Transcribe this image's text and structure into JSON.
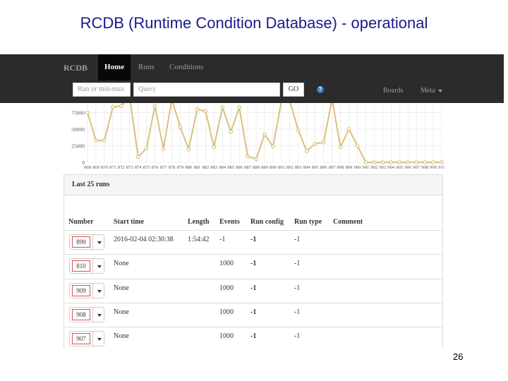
{
  "slide": {
    "title": "RCDB (Runtime Condition Database) - operational",
    "page_number": "26"
  },
  "navbar": {
    "brand": "RCDB",
    "home": "Home",
    "runs": "Runs",
    "conditions": "Conditions",
    "run_range_placeholder": "Run or min-max",
    "query_placeholder": "Query",
    "go": "GO",
    "help_icon": "question-icon",
    "boards": "Boards",
    "meta": "Meta",
    "colors": {
      "bg": "#2b2b2b",
      "active": "#080808"
    }
  },
  "chart_data": {
    "type": "line",
    "x": [
      "868",
      "869",
      "870",
      "871",
      "872",
      "873",
      "874",
      "875",
      "876",
      "877",
      "878",
      "879",
      "880",
      "881",
      "882",
      "883",
      "884",
      "885",
      "886",
      "887",
      "888",
      "889",
      "890",
      "891",
      "892",
      "893",
      "894",
      "895",
      "896",
      "897",
      "898",
      "899",
      "900",
      "901",
      "902",
      "903",
      "904",
      "905",
      "906",
      "907",
      "908",
      "909",
      "910"
    ],
    "x_tick_labels": [
      "868",
      "869",
      "870",
      "871",
      "872",
      "873",
      "874",
      "875",
      "876",
      "877",
      "878",
      "879",
      "880",
      "881",
      "882",
      "883",
      "884",
      "885",
      "886",
      "887",
      "888",
      "889",
      "890",
      "891",
      "892",
      "893",
      "894",
      "895",
      "896",
      "897",
      "898",
      "899",
      "900",
      "901",
      "902",
      "903",
      "904",
      "905",
      "906",
      "907",
      "908",
      "909",
      "910"
    ],
    "series": [
      {
        "values": [
          75000,
          33000,
          33000,
          83000,
          85000,
          100000,
          8000,
          21000,
          85000,
          20000,
          95000,
          53000,
          20000,
          80000,
          77000,
          23000,
          83000,
          46000,
          83000,
          9000,
          5000,
          42000,
          24000,
          92000,
          92000,
          48000,
          17000,
          28000,
          30000,
          95000,
          23000,
          50000,
          25000,
          0,
          0,
          0,
          0,
          0,
          0,
          0,
          0,
          0,
          0
        ],
        "color": "#d9c07a"
      }
    ],
    "y_tick_labels": [
      "0",
      "25000",
      "50000",
      "75000"
    ],
    "ylim": [
      0,
      100000
    ],
    "grid": true
  },
  "panel": {
    "title": "Last 25 runs",
    "columns": [
      "Number",
      "Start time",
      "Length",
      "Events",
      "Run config",
      "Run type",
      "Comment"
    ],
    "rows": [
      {
        "number": "899",
        "start_time": "2016-02-04 02:30:38",
        "length": "1:54:42",
        "events": "-1",
        "run_config": "-1",
        "run_type": "-1",
        "comment": ""
      },
      {
        "number": "810",
        "start_time": "None",
        "length": "",
        "events": "1000",
        "run_config": "-1",
        "run_type": "-1",
        "comment": ""
      },
      {
        "number": "909",
        "start_time": "None",
        "length": "",
        "events": "1000",
        "run_config": "-1",
        "run_type": "-1",
        "comment": ""
      },
      {
        "number": "908",
        "start_time": "None",
        "length": "",
        "events": "1000",
        "run_config": "-1",
        "run_type": "-1",
        "comment": ""
      },
      {
        "number": "907",
        "start_time": "None",
        "length": "",
        "events": "1000",
        "run_config": "-1",
        "run_type": "-1",
        "comment": ""
      }
    ]
  }
}
